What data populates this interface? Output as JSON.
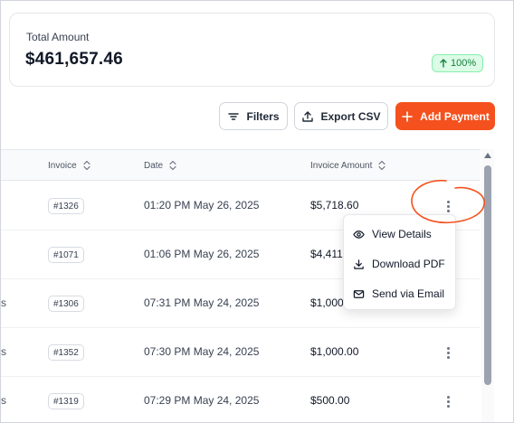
{
  "summary": {
    "label": "Total Amount",
    "amount": "$461,657.46",
    "change": "100%"
  },
  "toolbar": {
    "filters_label": "Filters",
    "export_label": "Export CSV",
    "add_label": "Add Payment"
  },
  "table": {
    "headers": {
      "invoice": "Invoice",
      "date": "Date",
      "amount": "Invoice Amount"
    },
    "rows": [
      {
        "edge": "",
        "invoice": "#1326",
        "date": "01:20 PM May 26, 2025",
        "amount": "$5,718.60"
      },
      {
        "edge": "",
        "invoice": "#1071",
        "date": "01:06 PM May 26, 2025",
        "amount": "$4,411."
      },
      {
        "edge": "s",
        "invoice": "#1306",
        "date": "07:31 PM May 24, 2025",
        "amount": "$1,000."
      },
      {
        "edge": "s",
        "invoice": "#1352",
        "date": "07:30 PM May 24, 2025",
        "amount": "$1,000.00"
      },
      {
        "edge": "s",
        "invoice": "#1319",
        "date": "07:29 PM May 24, 2025",
        "amount": "$500.00"
      }
    ]
  },
  "menu": {
    "view": "View Details",
    "download": "Download PDF",
    "email": "Send via Email"
  },
  "colors": {
    "accent": "#f4511e",
    "success": "#15803d",
    "success_bg": "#dcfce7"
  },
  "icons": {
    "filters": "filter-lines-icon",
    "export": "upload-icon",
    "add": "plus-icon",
    "sort": "sort-icon",
    "row_actions": "more-vertical-icon",
    "view": "eye-icon",
    "download": "download-icon",
    "email": "mail-icon",
    "trend": "arrow-up-icon"
  }
}
